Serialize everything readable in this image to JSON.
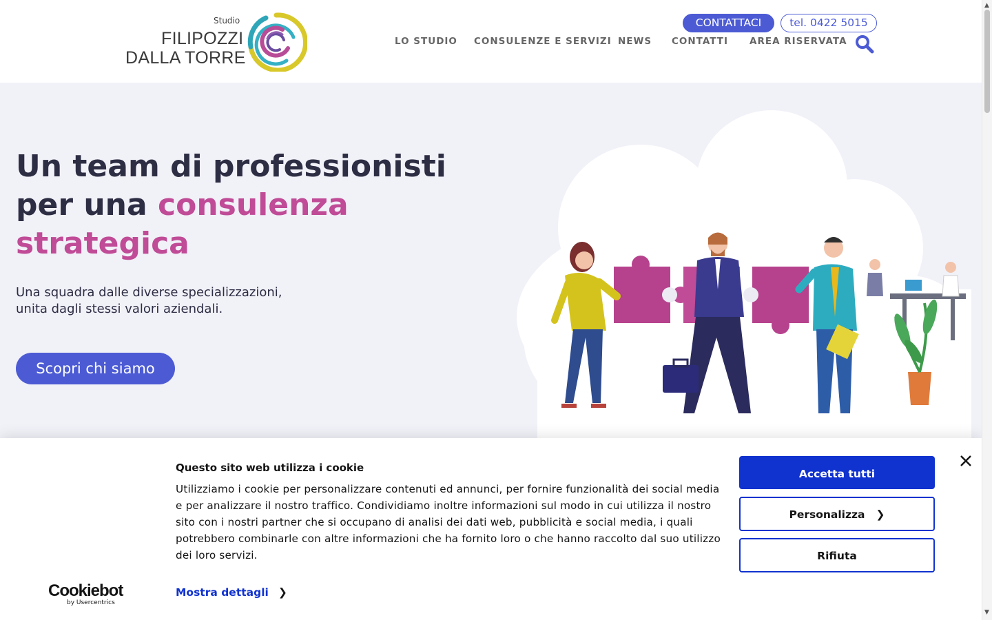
{
  "header": {
    "logo": {
      "studio": "Studio",
      "line1": "FILIPOZZI",
      "line2": "DALLA TORRE"
    },
    "contact_button": "CONTATTACI",
    "phone_button": "tel. 0422 5015",
    "nav": [
      "LO STUDIO",
      "CONSULENZE E SERVIZI",
      "NEWS",
      "CONTATTI",
      "AREA RISERVATA"
    ],
    "search_icon": "search-icon"
  },
  "hero": {
    "title_part1": "Un team di professionisti per una ",
    "title_accent": "consulenza strategica",
    "subtitle_line1": "Una squadra dalle diverse specializzazioni,",
    "subtitle_line2": "unita dagli stessi valori aziendali.",
    "cta": "Scopri chi siamo"
  },
  "cookie_banner": {
    "brand_main": "Cookiebot",
    "brand_sub": "by Usercentrics",
    "title": "Questo sito web utilizza i cookie",
    "body": "Utilizziamo i cookie per personalizzare contenuti ed annunci, per fornire funzionalità dei social media e per analizzare il nostro traffico. Condividiamo inoltre informazioni sul modo in cui utilizza il nostro sito con i nostri partner che si occupano di analisi dei dati web, pubblicità e social media, i quali potrebbero combinarle con altre informazioni che ha fornito loro o che hanno raccolto dal suo utilizzo dei loro servizi.",
    "details_link": "Mostra dettagli",
    "accept_all": "Accetta tutti",
    "customize": "Personalizza",
    "reject": "Rifiuta"
  },
  "colors": {
    "primary": "#4c5bd4",
    "accent": "#c04b96",
    "cookie_primary": "#1032cf",
    "hero_bg": "#f1f1f8",
    "text_dark": "#2d2d44"
  }
}
